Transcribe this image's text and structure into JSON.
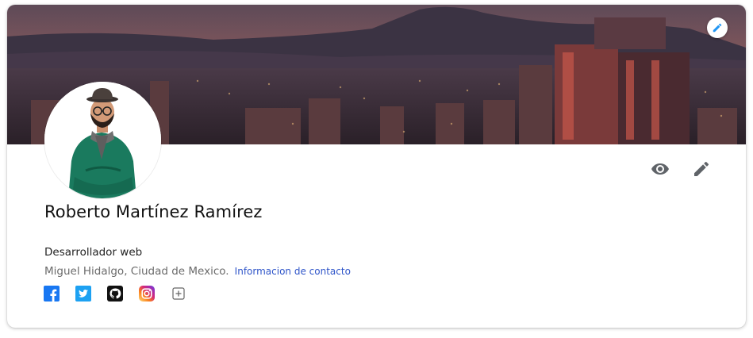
{
  "profile": {
    "name": "Roberto Martínez Ramírez",
    "headline": "Desarrollador web",
    "location": "Miguel Hidalgo, Ciudad de Mexico.",
    "contact_link": "Informacion de contacto"
  },
  "icons": {
    "banner_edit": "pencil-icon",
    "view": "eye-icon",
    "edit": "pencil-icon",
    "socials": [
      "facebook-icon",
      "twitter-icon",
      "github-icon",
      "instagram-icon",
      "add-box-icon"
    ]
  },
  "colors": {
    "accent": "#2196f3",
    "link": "#2f55c9",
    "facebook": "#1877f2",
    "twitter": "#1da1f2",
    "github": "#111111",
    "sweater": "#1a7a5e"
  }
}
